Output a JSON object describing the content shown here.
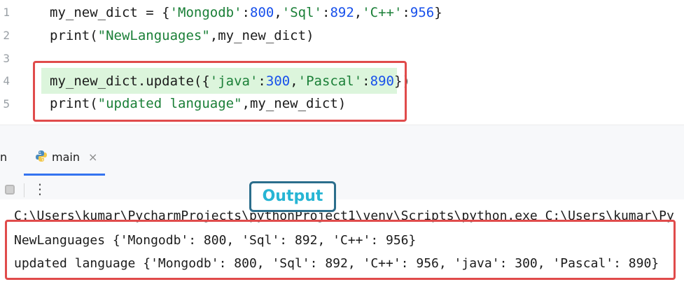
{
  "editor": {
    "line_numbers": [
      "1",
      "2",
      "3",
      "4",
      "5"
    ],
    "line1": {
      "p1": "my_new_dict = {",
      "s1": "'Mongodb'",
      "c1": ":",
      "n1": "800",
      "c2": ",",
      "s2": "'Sql'",
      "c3": ":",
      "n2": "892",
      "c4": ",",
      "s3": "'C++'",
      "c5": ":",
      "n3": "956",
      "end": "}"
    },
    "line2": {
      "p1": "print(",
      "s1": "\"NewLanguages\"",
      "end": ",my_new_dict)"
    },
    "line4": {
      "p1": "my_new_dict.update({",
      "s1": "'java'",
      "c1": ":",
      "n1": "300",
      "c2": ",",
      "s2": "'Pascal'",
      "c3": ":",
      "n2": "890",
      "end": "})"
    },
    "line5": {
      "p1": "print(",
      "s1": "\"updated language\"",
      "end": ",my_new_dict)"
    }
  },
  "run_panel": {
    "left_tab_fragment": "n",
    "tab_label": "main",
    "close_glyph": "×",
    "more_glyph": "⋮",
    "badge": "Output"
  },
  "console": {
    "line1": "C:\\Users\\kumar\\PycharmProjects\\pythonProject1\\venv\\Scripts\\python.exe C:\\Users\\kumar\\Py",
    "line2": "NewLanguages {'Mongodb': 800, 'Sql': 892, 'C++': 956}",
    "line3": "updated language {'Mongodb': 800, 'Sql': 892, 'C++': 956, 'java': 300, 'Pascal': 890}"
  },
  "colors": {
    "highlight_box": "#e04b4b",
    "badge_border": "#2c6e8c",
    "badge_text": "#27b5d4",
    "tab_underline": "#3574f0",
    "string": "#1a7f37",
    "number": "#1750eb"
  },
  "icons": {
    "tab_icon": "python-icon",
    "stop": "stop-icon",
    "more": "more-vertical-icon",
    "close": "close-icon"
  }
}
